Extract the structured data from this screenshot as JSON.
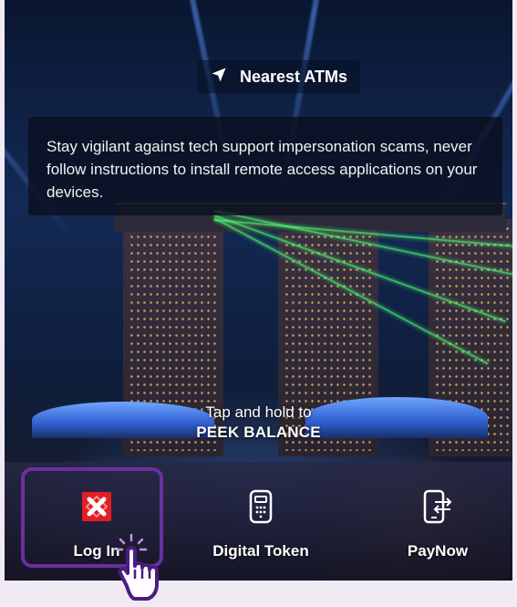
{
  "nearest_atms": {
    "label": "Nearest ATMs",
    "icon": "location-arrow-icon"
  },
  "notice": {
    "text": "Stay vigilant against tech support impersonation scams, never follow instructions to install remote access applications on your devices."
  },
  "peek": {
    "line1": "Tap and hold to",
    "line2": "PEEK BALANCE"
  },
  "actions": [
    {
      "label": "Log In",
      "icon": "dbs-logo-icon"
    },
    {
      "label": "Digital Token",
      "icon": "digital-token-icon"
    },
    {
      "label": "PayNow",
      "icon": "paynow-phone-icon"
    }
  ],
  "colors": {
    "highlight": "#6b2fa0",
    "brand_red": "#e31e24",
    "laser_green": "#50ff78"
  }
}
